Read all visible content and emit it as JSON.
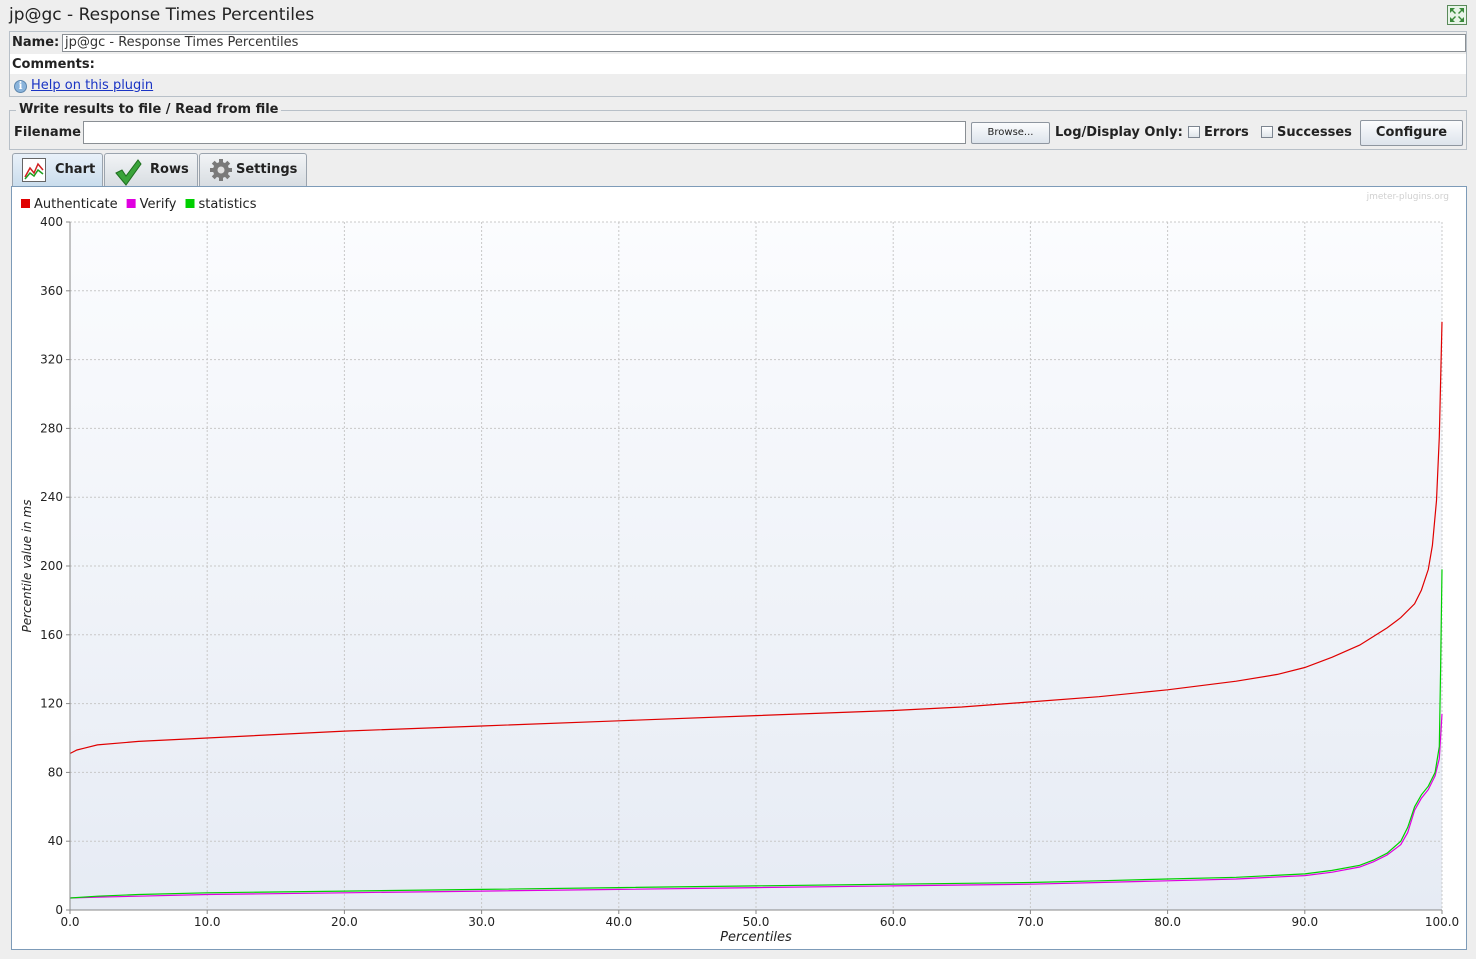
{
  "window": {
    "title": "jp@gc - Response Times Percentiles"
  },
  "name_field": {
    "label": "Name:",
    "value": "jp@gc - Response Times Percentiles"
  },
  "comments": {
    "label": "Comments:"
  },
  "help": {
    "link_text": "Help on this plugin",
    "icon": "info-icon"
  },
  "file_section": {
    "legend": "Write results to file / Read from file",
    "filename_label": "Filename",
    "filename_value": "",
    "browse_label": "Browse...",
    "log_display_label": "Log/Display Only:",
    "errors_label": "Errors",
    "errors_checked": false,
    "successes_label": "Successes",
    "successes_checked": false,
    "configure_label": "Configure"
  },
  "tabs": [
    {
      "label": "Chart",
      "icon": "chart-icon",
      "active": true
    },
    {
      "label": "Rows",
      "icon": "checkmark-icon",
      "active": false
    },
    {
      "label": "Settings",
      "icon": "gear-icon",
      "active": false
    }
  ],
  "chart_data": {
    "type": "line",
    "watermark": "jmeter-plugins.org",
    "xlabel": "Percentiles",
    "ylabel": "Percentile value in ms",
    "xlim": [
      0,
      100
    ],
    "ylim": [
      0,
      400
    ],
    "xticks": [
      "0.0",
      "10.0",
      "20.0",
      "30.0",
      "40.0",
      "50.0",
      "60.0",
      "70.0",
      "80.0",
      "90.0",
      "100.0"
    ],
    "yticks": [
      "0",
      "40",
      "80",
      "120",
      "160",
      "200",
      "240",
      "280",
      "320",
      "360",
      "400"
    ],
    "grid": true,
    "legend_position": "top-left",
    "series": [
      {
        "name": "Authenticate",
        "color": "#e00000",
        "x": [
          0,
          0.5,
          1,
          2,
          5,
          10,
          20,
          30,
          40,
          50,
          60,
          65,
          70,
          75,
          80,
          85,
          88,
          90,
          92,
          94,
          95,
          96,
          97,
          98,
          98.5,
          99,
          99.3,
          99.6,
          99.8,
          100
        ],
        "y": [
          91,
          93,
          94,
          96,
          98,
          100,
          104,
          107,
          110,
          113,
          116,
          118,
          121,
          124,
          128,
          133,
          137,
          141,
          147,
          154,
          159,
          164,
          170,
          178,
          186,
          198,
          212,
          238,
          275,
          342
        ]
      },
      {
        "name": "Verify",
        "color": "#e000e0",
        "x": [
          0,
          2,
          5,
          10,
          20,
          30,
          40,
          50,
          60,
          70,
          75,
          80,
          85,
          90,
          92,
          94,
          95,
          96,
          97,
          97.5,
          98,
          98.5,
          99,
          99.5,
          99.8,
          100
        ],
        "y": [
          7,
          7.5,
          8,
          9,
          10,
          11,
          12,
          13,
          14,
          15,
          16,
          17,
          18,
          20,
          22,
          25,
          28,
          32,
          38,
          45,
          58,
          65,
          70,
          78,
          88,
          114
        ]
      },
      {
        "name": "statistics",
        "color": "#00d000",
        "x": [
          0,
          2,
          5,
          10,
          20,
          30,
          40,
          50,
          60,
          70,
          75,
          80,
          85,
          90,
          92,
          94,
          95,
          96,
          97,
          97.5,
          98,
          98.5,
          99,
          99.5,
          99.8,
          99.9,
          100
        ],
        "y": [
          7,
          8,
          9,
          10,
          11,
          12,
          13,
          14,
          15,
          16,
          17,
          18,
          19,
          21,
          23,
          26,
          29,
          33,
          40,
          48,
          60,
          67,
          72,
          80,
          95,
          140,
          198
        ]
      }
    ]
  }
}
